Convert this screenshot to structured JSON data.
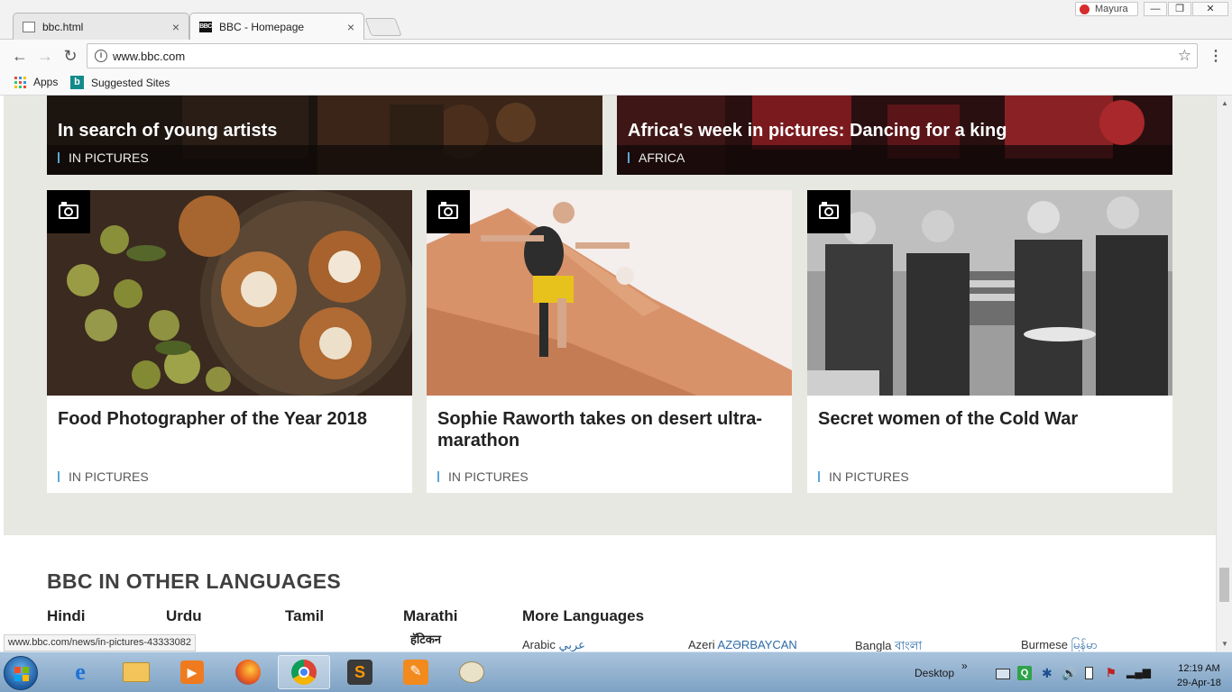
{
  "browser": {
    "tabs": [
      {
        "label": "bbc.html",
        "close": "×"
      },
      {
        "label": "BBC - Homepage",
        "close": "×",
        "favicon": "BBC"
      }
    ],
    "user_name": "Mayura",
    "address": "www.bbc.com",
    "bookmarks": {
      "apps": "Apps",
      "suggested": "Suggested Sites"
    },
    "status_url": "www.bbc.com/news/in-pictures-43333082"
  },
  "page": {
    "top_cards": [
      {
        "title": "In search of young artists",
        "tag": "IN PICTURES"
      },
      {
        "title": "Africa's week in pictures: Dancing for a king",
        "tag": "AFRICA"
      }
    ],
    "cards": [
      {
        "title": "Food Photographer of the Year 2018",
        "tag": "IN PICTURES"
      },
      {
        "title": "Sophie Raworth takes on desert ultra-marathon",
        "tag": "IN PICTURES"
      },
      {
        "title": "Secret women of the Cold War",
        "tag": "IN PICTURES"
      }
    ],
    "languages": {
      "heading": "BBC IN OTHER LANGUAGES",
      "columns": [
        "Hindi",
        "Urdu",
        "Tamil",
        "Marathi",
        "More Languages"
      ],
      "marathi_snippet": "हॅटिकन",
      "more": [
        {
          "name": "Arabic",
          "native": "عربي"
        },
        {
          "name": "Azeri",
          "native": "AZƏRBAYCAN"
        },
        {
          "name": "Bangla",
          "native": "বাংলা"
        },
        {
          "name": "Burmese",
          "native": "မြန်မာ"
        }
      ]
    }
  },
  "taskbar": {
    "desktop_label": "Desktop",
    "time": "12:19 AM",
    "date": "29-Apr-18"
  },
  "colors": {
    "accent_tag": "#5aa7d6",
    "grey_band": "#e8e8e3"
  }
}
